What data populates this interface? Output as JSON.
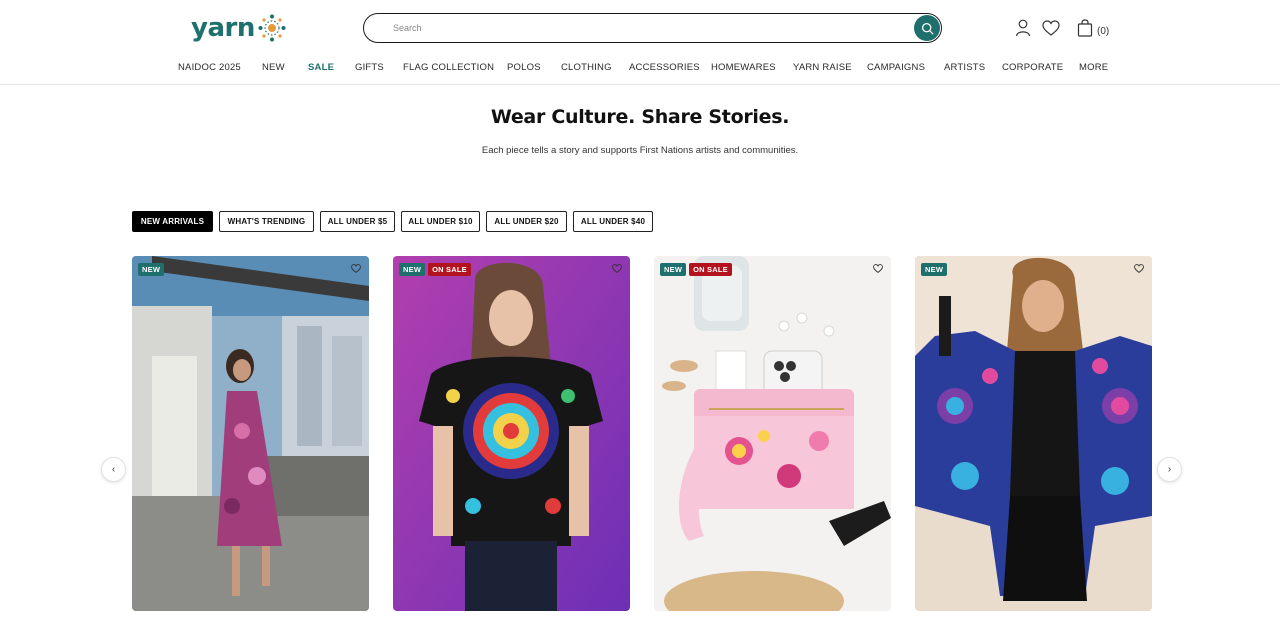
{
  "brand": {
    "name": "yarn",
    "accent": "#1f6f6c",
    "sale_color": "#b3121f"
  },
  "search": {
    "placeholder": "Search"
  },
  "header": {
    "cart_count": "(0)"
  },
  "nav": [
    {
      "label": "NAIDOC 2025"
    },
    {
      "label": "NEW"
    },
    {
      "label": "SALE"
    },
    {
      "label": "GIFTS"
    },
    {
      "label": "FLAG COLLECTION"
    },
    {
      "label": "POLOS"
    },
    {
      "label": "CLOTHING"
    },
    {
      "label": "ACCESSORIES"
    },
    {
      "label": "HOMEWARES"
    },
    {
      "label": "YARN RAISE"
    },
    {
      "label": "CAMPAIGNS"
    },
    {
      "label": "ARTISTS"
    },
    {
      "label": "CORPORATE"
    },
    {
      "label": "MORE"
    }
  ],
  "hero": {
    "title": "Wear Culture. Share Stories.",
    "subtitle": "Each piece tells a story and supports First Nations artists and communities."
  },
  "filters": [
    {
      "label": "NEW ARRIVALS",
      "active": true
    },
    {
      "label": "WHAT'S TRENDING",
      "active": false
    },
    {
      "label": "ALL UNDER $5",
      "active": false
    },
    {
      "label": "ALL UNDER $10",
      "active": false
    },
    {
      "label": "ALL UNDER $20",
      "active": false
    },
    {
      "label": "ALL UNDER $40",
      "active": false
    }
  ],
  "carousel": {
    "prev_glyph": "‹",
    "next_glyph": "›",
    "products": [
      {
        "badges": [
          "NEW"
        ],
        "image": "woman-in-pink-dress-city"
      },
      {
        "badges": [
          "NEW",
          "ON SALE"
        ],
        "image": "woman-in-dot-art-polo"
      },
      {
        "badges": [
          "NEW",
          "ON SALE"
        ],
        "image": "pink-floral-pouch-flatlay"
      },
      {
        "badges": [
          "NEW"
        ],
        "image": "woman-in-blue-kimono"
      }
    ]
  },
  "icons": {
    "search": "search-icon",
    "account": "user-icon",
    "wishlist": "heart-icon",
    "cart": "bag-icon"
  }
}
